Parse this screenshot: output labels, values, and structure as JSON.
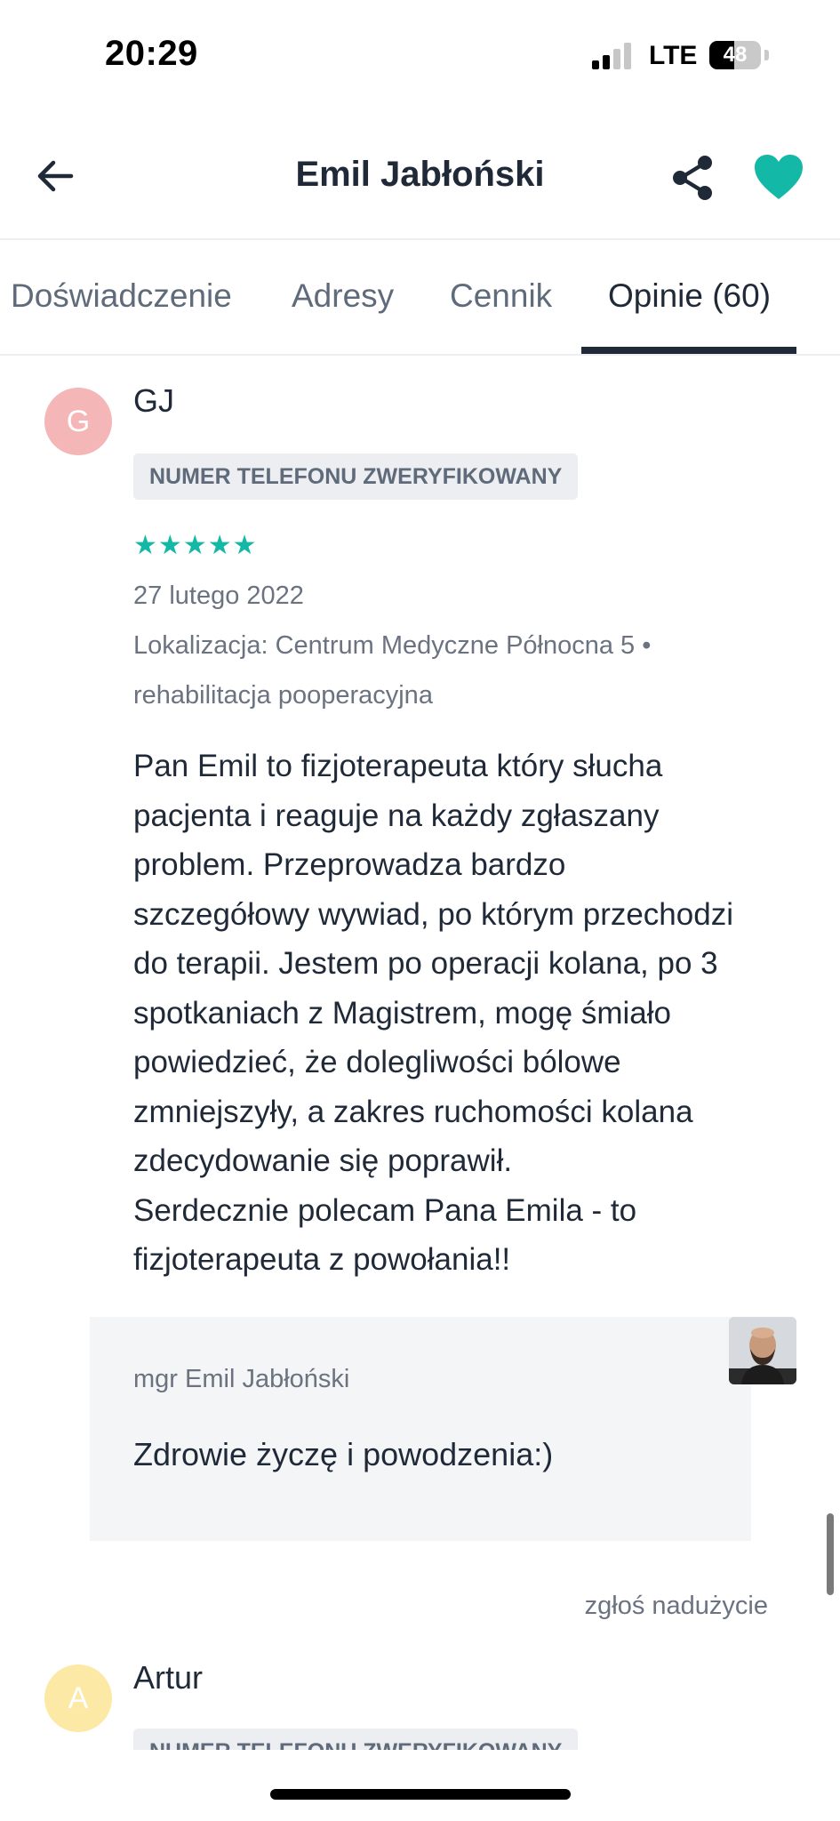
{
  "status_bar": {
    "time": "20:29",
    "network": "LTE",
    "battery_level": "48"
  },
  "header": {
    "title": "Emil Jabłoński",
    "back_icon": "arrow-left-icon",
    "share_icon": "share-icon",
    "favorite_icon": "heart-icon",
    "favorite_color": "#14b8a6"
  },
  "tabs": [
    {
      "label": "Doświadczenie"
    },
    {
      "label": "Adresy"
    },
    {
      "label": "Cennik"
    },
    {
      "label": "Opinie (60)",
      "active": true
    }
  ],
  "review": {
    "avatar_letter": "G",
    "avatar_color": "#f4b6b6",
    "name": "GJ",
    "badge": "NUMER TELEFONU ZWERYFIKOWANY",
    "rating": 5,
    "rating_max": 5,
    "star_color": "#14b8a6",
    "date": "27 lutego 2022",
    "location_line": "Lokalizacja: Centrum Medyczne Północna 5 •",
    "service": "rehabilitacja pooperacyjna",
    "text_lines": [
      "Pan Emil to fizjoterapeuta który słucha",
      "pacjenta i reaguje na każdy zgłaszany",
      "problem. Przeprowadza bardzo",
      "szczegółowy wywiad, po którym przechodzi",
      "do terapii. Jestem po operacji kolana, po 3",
      "spotkaniach z Magistrem, mogę śmiało",
      "powiedzieć, że dolegliwości bólowe",
      "zmniejszyły, a zakres ruchomości kolana",
      "zdecydowanie się poprawił.",
      "Serdecznie polecam Pana Emila - to",
      "fizjoterapeuta z powołania!!"
    ],
    "reply": {
      "author": "mgr Emil Jabłoński",
      "text": "Zdrowie życzę i powodzenia:)"
    },
    "report_label": "zgłoś nadużycie"
  },
  "next_review": {
    "avatar_letter": "A",
    "avatar_color": "#fde9a6",
    "name": "Artur",
    "badge": "NUMER TELEFONU ZWERYFIKOWANY"
  }
}
